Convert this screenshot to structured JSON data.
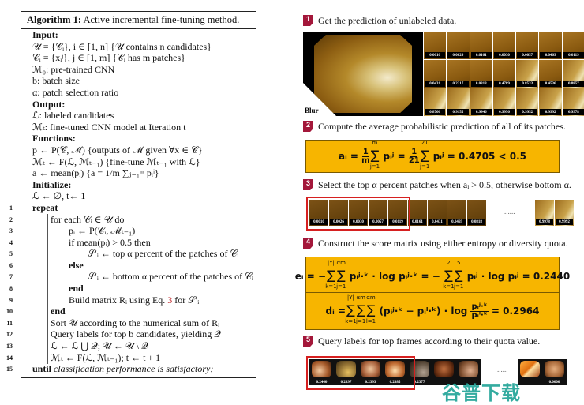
{
  "algorithm": {
    "title_label": "Algorithm 1:",
    "title_text": "Active incremental fine-tuning method.",
    "input_header": "Input",
    "inputs": [
      "𝒰 = {𝒞ᵢ}, i ∈ [1, n] {𝒰 contains n candidates}",
      "𝒞ᵢ = {xᵢʲ}, j ∈ [1, m] {𝒞ᵢ has m patches}",
      "ℳ₀: pre-trained CNN",
      "b: batch size",
      "α: patch selection ratio"
    ],
    "output_header": "Output",
    "outputs": [
      "ℒ: labeled candidates",
      "ℳₜ: fine-tuned CNN model at Iteration t"
    ],
    "functions_header": "Functions",
    "functions": [
      "p ← P(𝒞, ℳ) {outputs of ℳ given ∀x ∈ 𝒞}",
      "ℳₜ ← F(ℒ, ℳₜ₋₁) {fine-tune ℳₜ₋₁ with ℒ}",
      "a ← mean(pᵢ) {a = 1/m ∑ⱼ₌₁ᵐ pᵢʲ}"
    ],
    "initialize_header": "Initialize",
    "initialize": "ℒ ← ∅, t← 1",
    "steps": [
      {
        "num": "1",
        "text": "repeat"
      },
      {
        "num": "2",
        "text": "for each 𝒞ᵢ ∈ 𝒰 do"
      },
      {
        "num": "3",
        "text": "pᵢ ← P(𝒞ᵢ, ℳₜ₋₁)"
      },
      {
        "num": "4",
        "text": "if mean(pᵢ) > 0.5 then"
      },
      {
        "num": "5",
        "text": "𝒮′ᵢ ← top α percent of the patches of 𝒞ᵢ"
      },
      {
        "num": "6",
        "text": "else"
      },
      {
        "num": "7",
        "text": "𝒮′ᵢ ← bottom α percent of the patches of 𝒞ᵢ"
      },
      {
        "num": "8",
        "text": "end"
      },
      {
        "num": "9",
        "text_pre": "Build matrix Rᵢ using Eq. ",
        "ref": "3",
        "text_post": " for 𝒮′ᵢ"
      },
      {
        "num": "10",
        "text": "end"
      },
      {
        "num": "11",
        "text": "Sort 𝒰 according to the numerical sum of Rᵢ"
      },
      {
        "num": "12",
        "text": "Query labels for top b candidates, yielding 𝒬"
      },
      {
        "num": "13",
        "text": "ℒ ← ℒ ⋃ 𝒬;   𝒰 ← 𝒰 \\ 𝒬"
      },
      {
        "num": "14",
        "text": "ℳₜ ← F(ℒ, ℳₜ₋₁); t ← t + 1"
      },
      {
        "num": "15",
        "text_pre": "until ",
        "text_post": "classification performance is satisfactory;"
      }
    ]
  },
  "figure": {
    "accent_color": "#a3173a",
    "formula_bg_color": "#f7b500",
    "highlight_color": "#d62020",
    "steps": [
      {
        "num": "1",
        "text": "Get the prediction of unlabeled data."
      },
      {
        "num": "2",
        "text": "Compute the average probabilistic prediction of all of its patches."
      },
      {
        "num": "3",
        "text": "Select the top α percent patches when aᵢ > 0.5, otherwise bottom α."
      },
      {
        "num": "4",
        "text": "Construct the score matrix using either entropy or diversity quota."
      },
      {
        "num": "5",
        "text": "Query labels for top frames according to their quota value."
      }
    ],
    "image_tag": "Blur",
    "patch_values": [
      [
        "0.0010",
        "0.0026",
        "0.0161",
        "0.0030",
        "0.0057",
        "0.0469",
        "0.0119"
      ],
      [
        "0.0431",
        "0.2217",
        "0.0818",
        "0.4789",
        "0.8533",
        "0.4536",
        "0.8857"
      ],
      [
        "0.8766",
        "0.9155",
        "0.9946",
        "0.9956",
        "0.9952",
        "0.9992",
        "0.9978"
      ]
    ],
    "formula_average": {
      "lhs": "aᵢ =",
      "frac1_num": "1",
      "frac1_den": "m",
      "sum1_up": "m",
      "sum1_dn": "j=1",
      "term1": "pᵢʲ =",
      "frac2_num": "1",
      "frac2_den": "21",
      "sum2_up": "21",
      "sum2_dn": "j=1",
      "term2": "pᵢʲ",
      "rhs": "= 0.4705 < 0.5"
    },
    "sorted_patches": [
      "0.0010",
      "0.0026",
      "0.0030",
      "0.0057",
      "0.0119",
      "0.0161",
      "0.0431",
      "0.0469",
      "0.0818"
    ],
    "sorted_tail": [
      "0.9978",
      "0.9992"
    ],
    "selected_count": 5,
    "ellipsis": "......",
    "formula_entropy": {
      "lhs": "eᵢ = −",
      "s1_up": "|Y|",
      "s1_dn": "k=1",
      "s2_up": "αm",
      "s2_dn": "j=1",
      "mid": "pᵢʲ·ᵏ · log pᵢʲ·ᵏ = −",
      "s3_up": "2",
      "s3_dn": "k=1",
      "s4_up": "5",
      "s4_dn": "j=1",
      "rhs": "pᵢʲ · log pᵢʲ = 0.2440"
    },
    "formula_diversity": {
      "lhs": "dᵢ =",
      "s1_up": "|Y|",
      "s1_dn": "k=1",
      "s2_up": "αm",
      "s2_dn": "j=1",
      "s3_up": "αm",
      "s3_dn": "l=1",
      "mid": "(pᵢʲ·ᵏ − pᵢˡ·ᵏ) · log",
      "frac_num": "pᵢʲ·ᵏ",
      "frac_den": "pᵢˡ·ᵏ",
      "rhs": "= 0.2964"
    },
    "frame_values": [
      "0.2440",
      "0.2397",
      "0.2393",
      "0.2385",
      "0.2377",
      "",
      "",
      "",
      "0.0000"
    ],
    "frames_selected_count": 4
  },
  "watermark": "谷普下载"
}
